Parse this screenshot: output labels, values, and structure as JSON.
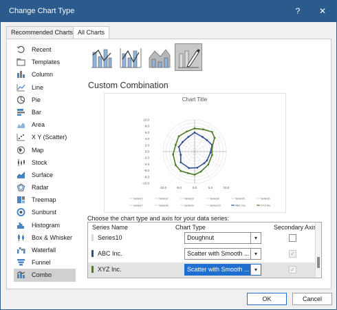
{
  "window": {
    "title": "Change Chart Type",
    "help_label": "?",
    "close_label": "✕"
  },
  "tabs": [
    {
      "label": "Recommended Charts",
      "active": false
    },
    {
      "label": "All Charts",
      "active": true
    }
  ],
  "sidebar": {
    "selected": "Combo",
    "items": [
      {
        "label": "Recent",
        "icon": "recent-icon"
      },
      {
        "label": "Templates",
        "icon": "folder-icon"
      },
      {
        "label": "Column",
        "icon": "column-chart-icon"
      },
      {
        "label": "Line",
        "icon": "line-chart-icon"
      },
      {
        "label": "Pie",
        "icon": "pie-chart-icon"
      },
      {
        "label": "Bar",
        "icon": "bar-chart-icon"
      },
      {
        "label": "Area",
        "icon": "area-chart-icon"
      },
      {
        "label": "X Y (Scatter)",
        "icon": "scatter-chart-icon"
      },
      {
        "label": "Map",
        "icon": "map-chart-icon"
      },
      {
        "label": "Stock",
        "icon": "stock-chart-icon"
      },
      {
        "label": "Surface",
        "icon": "surface-chart-icon"
      },
      {
        "label": "Radar",
        "icon": "radar-chart-icon"
      },
      {
        "label": "Treemap",
        "icon": "treemap-chart-icon"
      },
      {
        "label": "Sunburst",
        "icon": "sunburst-chart-icon"
      },
      {
        "label": "Histogram",
        "icon": "histogram-chart-icon"
      },
      {
        "label": "Box & Whisker",
        "icon": "box-whisker-chart-icon"
      },
      {
        "label": "Waterfall",
        "icon": "waterfall-chart-icon"
      },
      {
        "label": "Funnel",
        "icon": "funnel-chart-icon"
      },
      {
        "label": "Combo",
        "icon": "combo-chart-icon"
      }
    ]
  },
  "combo_types": [
    {
      "icon": "clustered-column-line-icon",
      "selected": false
    },
    {
      "icon": "clustered-column-line-secondary-axis-icon",
      "selected": false
    },
    {
      "icon": "stacked-area-clustered-column-icon",
      "selected": false
    },
    {
      "icon": "custom-combination-icon",
      "selected": true
    }
  ],
  "heading": "Custom Combination",
  "preview": {
    "title": "Chart Title",
    "y_ticks": [
      "10.0",
      "8.0",
      "6.0",
      "4.0",
      "2.0",
      "0.0",
      "-2.0",
      "-4.0",
      "-6.0",
      "-8.0",
      "-10.0"
    ],
    "x_ticks": [
      "-10.0",
      "-5.0",
      "0.0",
      "5.0",
      "10.0"
    ],
    "legend": [
      "Series1",
      "Series2",
      "Series3",
      "Series4",
      "Series5",
      "Series6",
      "Series7",
      "Series8",
      "Series9",
      "Series10",
      "ABC Inc.",
      "XYZ Inc."
    ],
    "colors": {
      "abc": "#2f4f8f",
      "xyz": "#4f7a28",
      "grid": "#d9d9d9"
    }
  },
  "chart_data": {
    "type": "scatter",
    "title": "Chart Title",
    "xlim": [
      -10,
      10
    ],
    "ylim": [
      -10,
      10
    ],
    "grid": true,
    "legend_position": "bottom",
    "series": [
      {
        "name": "ABC Inc.",
        "x": [
          0,
          2.5,
          3.9,
          5.5,
          5.0,
          3.9,
          3.0,
          0.8,
          -1.8,
          -4.4,
          -4.4,
          -5.0,
          -3.8,
          -2.0,
          0
        ],
        "y": [
          6.0,
          4.6,
          3.6,
          2.1,
          -0.3,
          -2.8,
          -3.7,
          -5.1,
          -5.2,
          -3.4,
          -1.0,
          1.5,
          3.0,
          4.6,
          6.0
        ]
      },
      {
        "name": "XYZ Inc.",
        "x": [
          0,
          2.7,
          5.5,
          6.3,
          5.5,
          5.5,
          4.3,
          2.0,
          0,
          -2.1,
          -4.4,
          -6.0,
          -6.8,
          -6.0,
          -5.0,
          -2.5,
          0
        ],
        "y": [
          7.3,
          7.0,
          6.2,
          4.3,
          1.3,
          -1.1,
          -4.1,
          -6.3,
          -7.3,
          -6.8,
          -6.1,
          -4.3,
          -0.9,
          2.1,
          4.8,
          6.3,
          7.3
        ]
      }
    ]
  },
  "series_section": {
    "label": "Choose the chart type and axis for your data series:",
    "headers": {
      "name": "Series Name",
      "type": "Chart Type",
      "secondary": "Secondary Axis"
    },
    "rows": [
      {
        "name": "Series10",
        "type": "Doughnut",
        "secondary": false,
        "color": "#d9d9d9",
        "active": false,
        "check_disabled": false
      },
      {
        "name": "ABC Inc.",
        "type": "Scatter with Smooth ...",
        "secondary": true,
        "color": "#2f4f8f",
        "active": false,
        "check_disabled": true
      },
      {
        "name": "XYZ Inc.",
        "type": "Scatter with Smooth ...",
        "secondary": true,
        "color": "#4f7a28",
        "active": true,
        "check_disabled": true
      }
    ]
  },
  "footer": {
    "ok_label": "OK",
    "cancel_label": "Cancel"
  }
}
